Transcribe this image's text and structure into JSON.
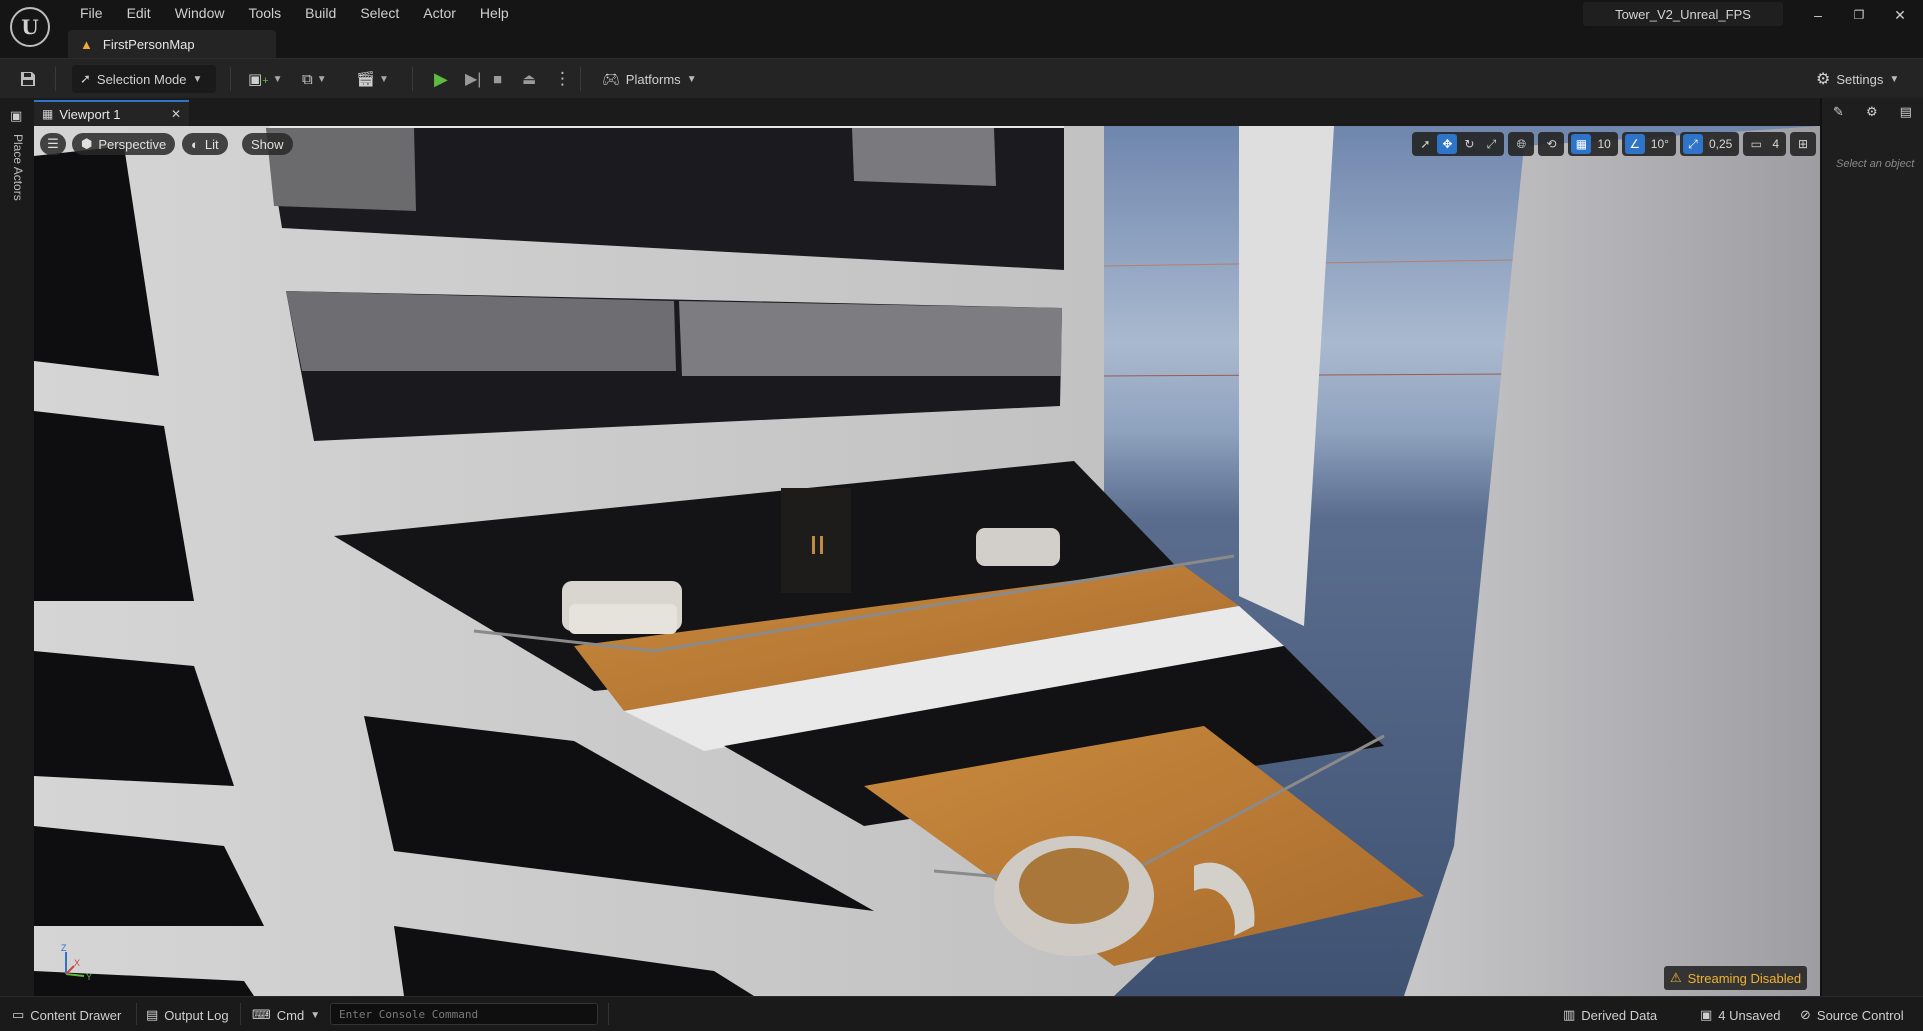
{
  "app": {
    "logo": "unreal-logo-icon",
    "project_name": "Tower_V2_Unreal_FPS",
    "map_tab": "FirstPersonMap"
  },
  "menu": [
    "File",
    "Edit",
    "Window",
    "Tools",
    "Build",
    "Select",
    "Actor",
    "Help"
  ],
  "window_controls": {
    "minimize": "–",
    "restore": "❐",
    "close": "✕"
  },
  "toolbar": {
    "selection_mode": "Selection Mode",
    "platforms": "Platforms",
    "settings": "Settings"
  },
  "left_panel": {
    "place_actors": "Place Actors"
  },
  "viewport": {
    "tab_label": "Viewport 1",
    "perspective": "Perspective",
    "lit": "Lit",
    "show": "Show",
    "grid_snap": "10",
    "rotation_snap": "10°",
    "scale_snap": "0,25",
    "camera_speed": "4",
    "streaming_warning": "Streaming Disabled"
  },
  "details_panel": {
    "hint": "Select an object"
  },
  "statusbar": {
    "content_drawer": "Content Drawer",
    "output_log": "Output Log",
    "cmd": "Cmd",
    "console_placeholder": "Enter Console Command",
    "derived_data": "Derived Data",
    "unsaved": "4 Unsaved",
    "source_control": "Source Control"
  },
  "colors": {
    "accent": "#2e74c9",
    "play": "#5dbb3f",
    "warning": "#f0b333",
    "background": "#151515",
    "panel": "#242424"
  }
}
